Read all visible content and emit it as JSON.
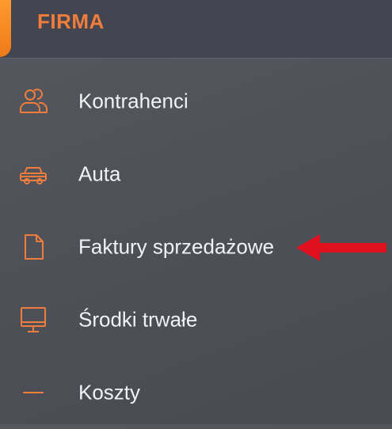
{
  "header": {
    "title": "FIRMA"
  },
  "menu": {
    "items": [
      {
        "label": "Kontrahenci",
        "icon": "users-icon"
      },
      {
        "label": "Auta",
        "icon": "car-icon"
      },
      {
        "label": "Faktury sprzedażowe",
        "icon": "document-icon"
      },
      {
        "label": "Środki trwałe",
        "icon": "monitor-icon"
      },
      {
        "label": "Koszty",
        "icon": "minus-icon"
      }
    ]
  },
  "colors": {
    "accent": "#f07d3c",
    "annotation_arrow": "#e0101e",
    "text": "#f2f2f4",
    "background": "#52545c"
  }
}
